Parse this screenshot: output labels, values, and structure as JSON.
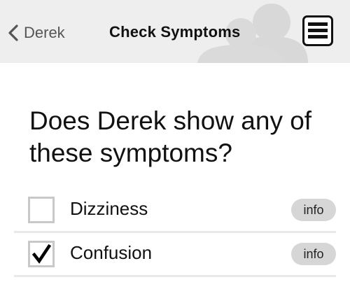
{
  "header": {
    "back_label": "Derek",
    "title": "Check Symptoms",
    "back_icon": "chevron-left-icon",
    "menu_icon": "hamburger-menu-icon",
    "background_icon": "people-icon"
  },
  "main": {
    "question": "Does Derek show any of these symptoms?",
    "symptoms": [
      {
        "label": "Dizziness",
        "checked": false,
        "info_label": "info"
      },
      {
        "label": "Confusion",
        "checked": true,
        "info_label": "info"
      }
    ]
  },
  "colors": {
    "header_background": "#eeeeee",
    "checkbox_border": "#c8c8c8",
    "info_pill": "#d6d6d6",
    "divider": "#e9e9e9"
  }
}
